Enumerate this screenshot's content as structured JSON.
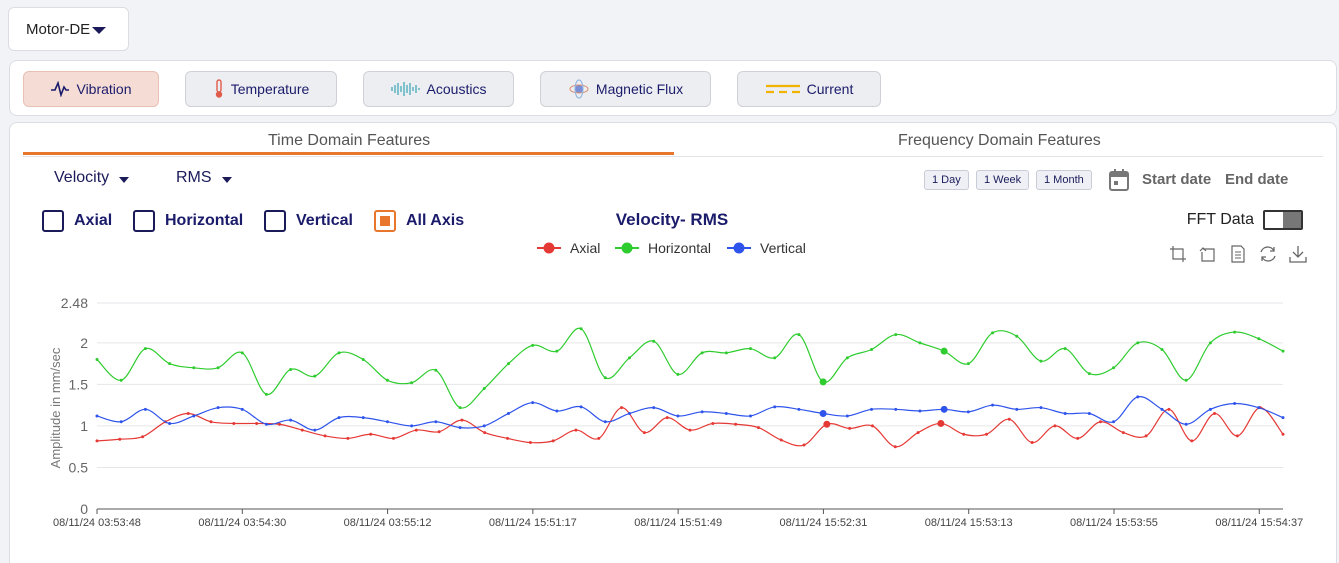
{
  "asset": {
    "selected": "Motor-DE"
  },
  "sensor_tabs": [
    {
      "label": "Vibration",
      "icon": "vibration-icon"
    },
    {
      "label": "Temperature",
      "icon": "thermometer-icon"
    },
    {
      "label": "Acoustics",
      "icon": "sound-wave-icon"
    },
    {
      "label": "Magnetic Flux",
      "icon": "magnet-flux-icon"
    },
    {
      "label": "Current",
      "icon": "current-dashes-icon"
    }
  ],
  "domain_tabs": {
    "time": "Time Domain Features",
    "frequency": "Frequency Domain Features"
  },
  "filters": {
    "measure": "Velocity",
    "statistic": "RMS"
  },
  "ranges": [
    "1 Day",
    "1 Week",
    "1 Month"
  ],
  "dates": {
    "start": "Start date",
    "end": "End date"
  },
  "axes": [
    {
      "label": "Axial",
      "checked": false
    },
    {
      "label": "Horizontal",
      "checked": false
    },
    {
      "label": "Vertical",
      "checked": false
    },
    {
      "label": "All Axis",
      "checked": true
    }
  ],
  "fft": {
    "label": "FFT Data",
    "enabled": false
  },
  "colors": {
    "accent": "#e8762d",
    "navy": "#1b1b6b",
    "axial": "#e53935",
    "horizontal": "#2ecc2e",
    "vertical": "#2f54eb"
  },
  "chart_data": {
    "type": "line",
    "title": "Velocity- RMS",
    "ylabel": "Amplitude in mm/sec",
    "xlabel": "",
    "ylim": [
      0,
      2.48
    ],
    "yticks": [
      "2.48",
      "2",
      "1.5",
      "1",
      "0.5",
      "0"
    ],
    "xticks": [
      "08/11/24 03:53:48",
      "08/11/24 03:54:30",
      "08/11/24 03:55:12",
      "08/11/24 15:51:17",
      "08/11/24 15:51:49",
      "08/11/24 15:52:31",
      "08/11/24 15:53:13",
      "08/11/24 15:53:55",
      "08/11/24 15:54:37"
    ],
    "grid": true,
    "legend": "top-center",
    "highlight_index": [
      32,
      37
    ],
    "series": [
      {
        "name": "Axial",
        "values": [
          0.82,
          0.84,
          0.87,
          1.05,
          1.15,
          1.05,
          1.03,
          1.03,
          1.02,
          0.95,
          0.88,
          0.85,
          0.9,
          0.85,
          0.95,
          0.93,
          1.07,
          0.92,
          0.85,
          0.8,
          0.82,
          0.95,
          0.85,
          1.22,
          0.92,
          1.1,
          0.95,
          1.03,
          1.02,
          0.98,
          0.83,
          0.77,
          1.02,
          0.97,
          1.0,
          0.75,
          0.92,
          1.03,
          0.9,
          0.9,
          1.08,
          0.8,
          1.0,
          0.85,
          1.05,
          0.92,
          0.88,
          1.2,
          0.82,
          1.15,
          0.88,
          1.22,
          0.9
        ]
      },
      {
        "name": "Horizontal",
        "values": [
          1.8,
          1.55,
          1.93,
          1.75,
          1.7,
          1.7,
          1.88,
          1.38,
          1.68,
          1.6,
          1.88,
          1.8,
          1.55,
          1.52,
          1.67,
          1.22,
          1.45,
          1.75,
          1.97,
          1.9,
          2.17,
          1.58,
          1.82,
          2.02,
          1.62,
          1.88,
          1.88,
          1.93,
          1.82,
          2.1,
          1.53,
          1.82,
          1.92,
          2.1,
          2.0,
          1.9,
          1.75,
          2.12,
          2.08,
          1.78,
          1.93,
          1.63,
          1.7,
          2.0,
          1.92,
          1.55,
          2.0,
          2.13,
          2.05,
          1.9
        ]
      },
      {
        "name": "Vertical",
        "values": [
          1.12,
          1.05,
          1.2,
          1.03,
          1.12,
          1.22,
          1.2,
          1.02,
          1.07,
          0.95,
          1.1,
          1.1,
          1.05,
          1.0,
          1.05,
          0.98,
          1.0,
          1.15,
          1.28,
          1.18,
          1.23,
          1.05,
          1.15,
          1.22,
          1.12,
          1.17,
          1.15,
          1.12,
          1.23,
          1.2,
          1.15,
          1.12,
          1.2,
          1.2,
          1.18,
          1.2,
          1.17,
          1.25,
          1.2,
          1.22,
          1.15,
          1.15,
          1.05,
          1.35,
          1.2,
          1.02,
          1.2,
          1.27,
          1.22,
          1.1
        ]
      }
    ]
  }
}
